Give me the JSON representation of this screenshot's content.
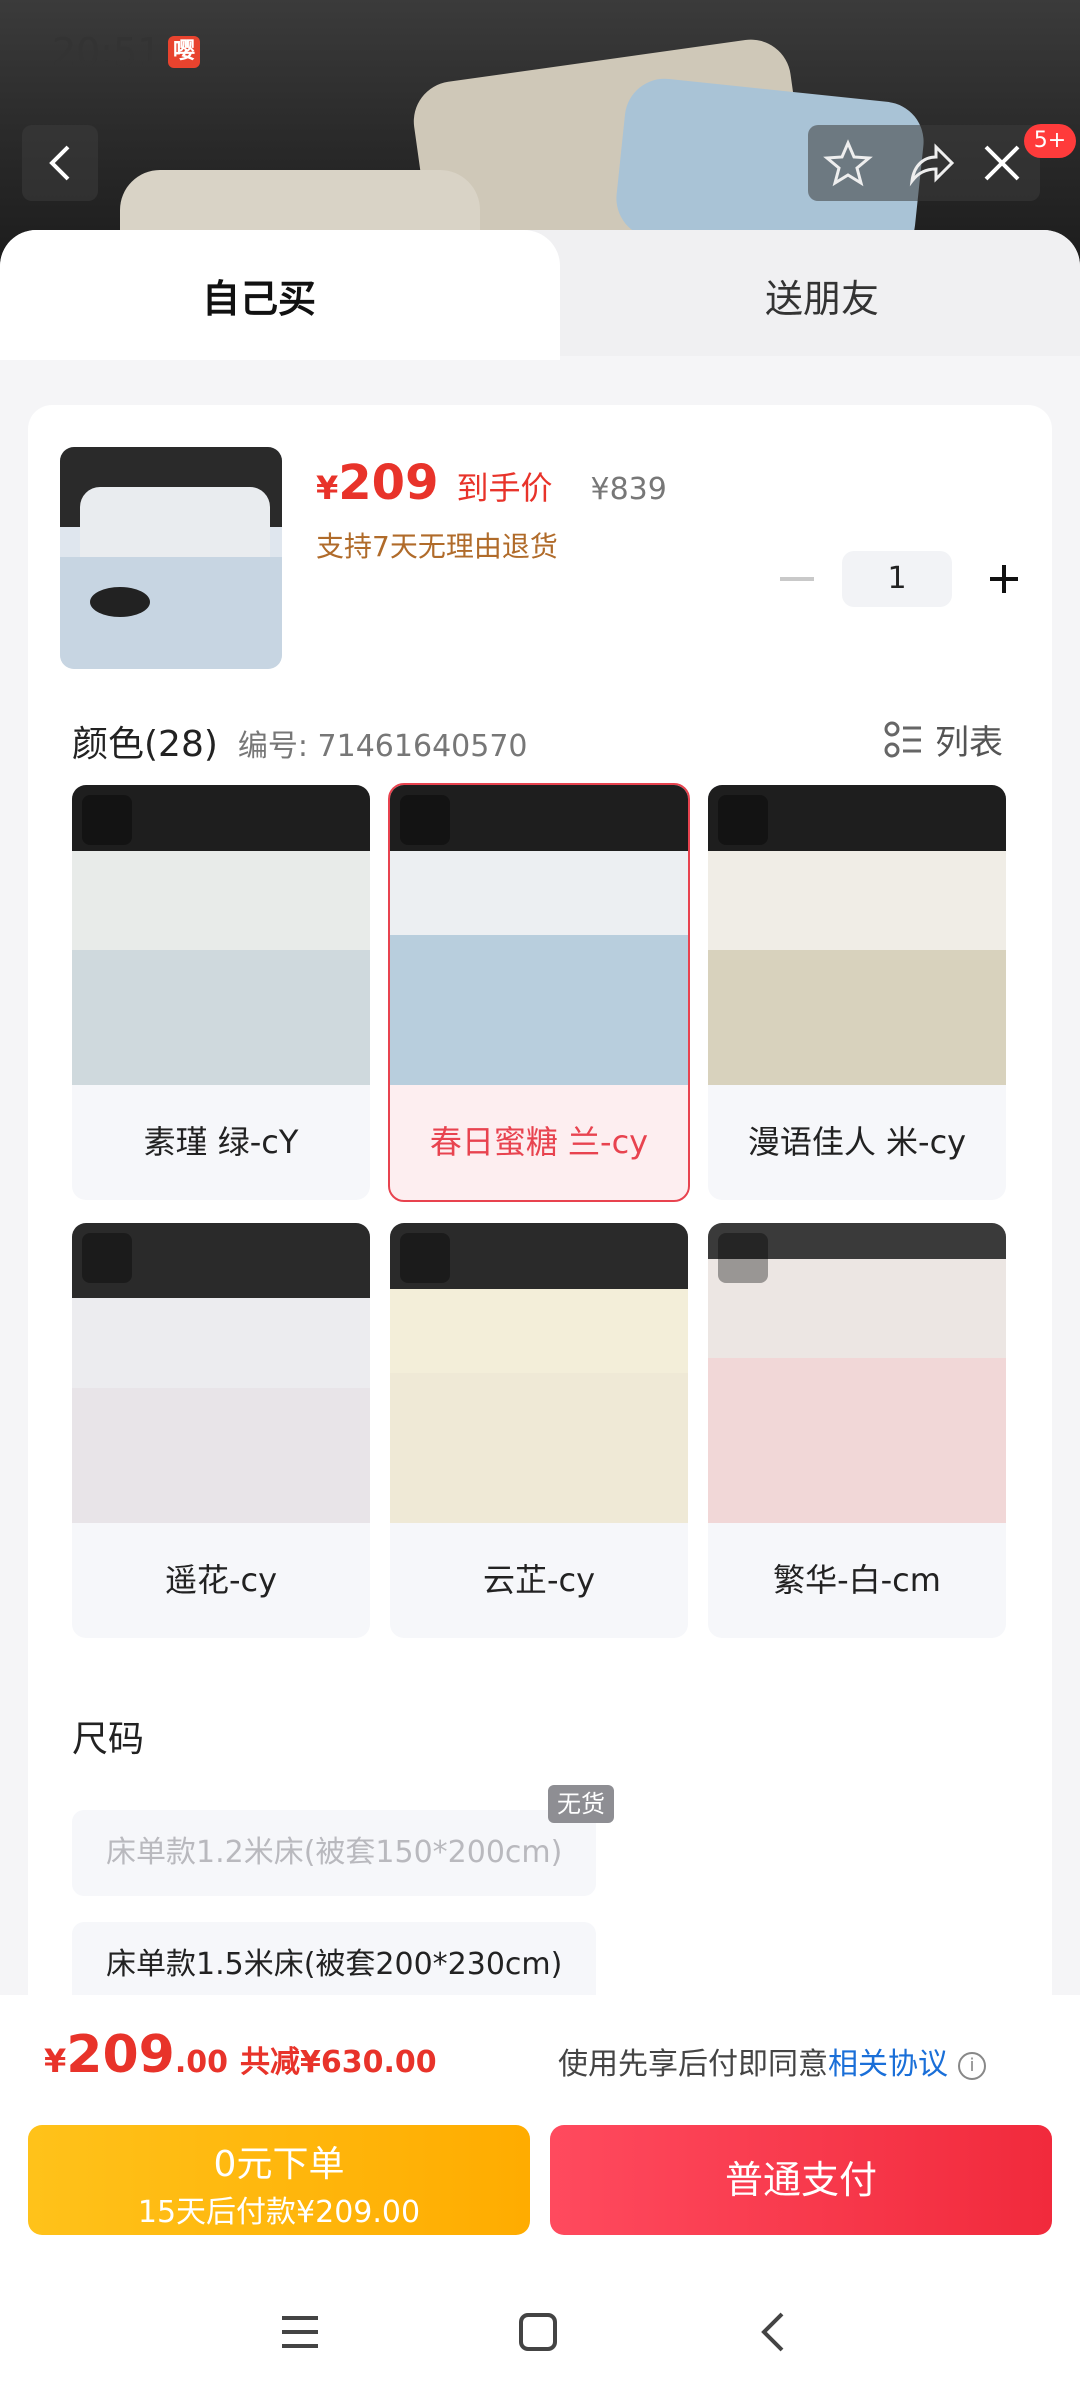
{
  "status": {
    "time": "20:51",
    "app_badge": "嘤"
  },
  "header": {
    "notification_count": "5+"
  },
  "tabs": [
    {
      "label": "自己买",
      "active": true
    },
    {
      "label": "送朋友",
      "active": false
    }
  ],
  "product": {
    "price_symbol": "¥",
    "price": "209",
    "price_tag": "到手价",
    "original_price": "¥839",
    "return_policy": "支持7天无理由退货",
    "quantity": "1"
  },
  "color_section": {
    "title": "颜色(28)",
    "code": "编号: 71461640570",
    "list_label": "列表",
    "options": [
      {
        "label": "素瑾 绿-cY",
        "selected": false
      },
      {
        "label": "春日蜜糖 兰-cy",
        "selected": true
      },
      {
        "label": "漫语佳人 米-cy",
        "selected": false
      },
      {
        "label": "遥花-cy",
        "selected": false
      },
      {
        "label": "云芷-cy",
        "selected": false
      },
      {
        "label": "繁华-白-cm",
        "selected": false
      }
    ]
  },
  "size_section": {
    "title": "尺码",
    "options": [
      {
        "label": "床单款1.2米床(被套150*200cm)",
        "available": false,
        "badge": "无货"
      },
      {
        "label": "床单款1.5米床(被套200*230cm)",
        "available": true
      }
    ]
  },
  "footer": {
    "total_symbol": "¥",
    "total_int": "209",
    "total_dec": ".00",
    "savings": "共减¥630.00",
    "agree_text": "使用先享后付即同意",
    "agree_link": "相关协议",
    "bnpl_line1": "0元下单",
    "bnpl_line2": "15天后付款¥209.00",
    "pay_label": "普通支付"
  },
  "colors": {
    "accent_red": "#e8332a",
    "pay_red": "#f12a3c",
    "bnpl_yellow": "#ffb300",
    "link_blue": "#1a6fd8"
  }
}
